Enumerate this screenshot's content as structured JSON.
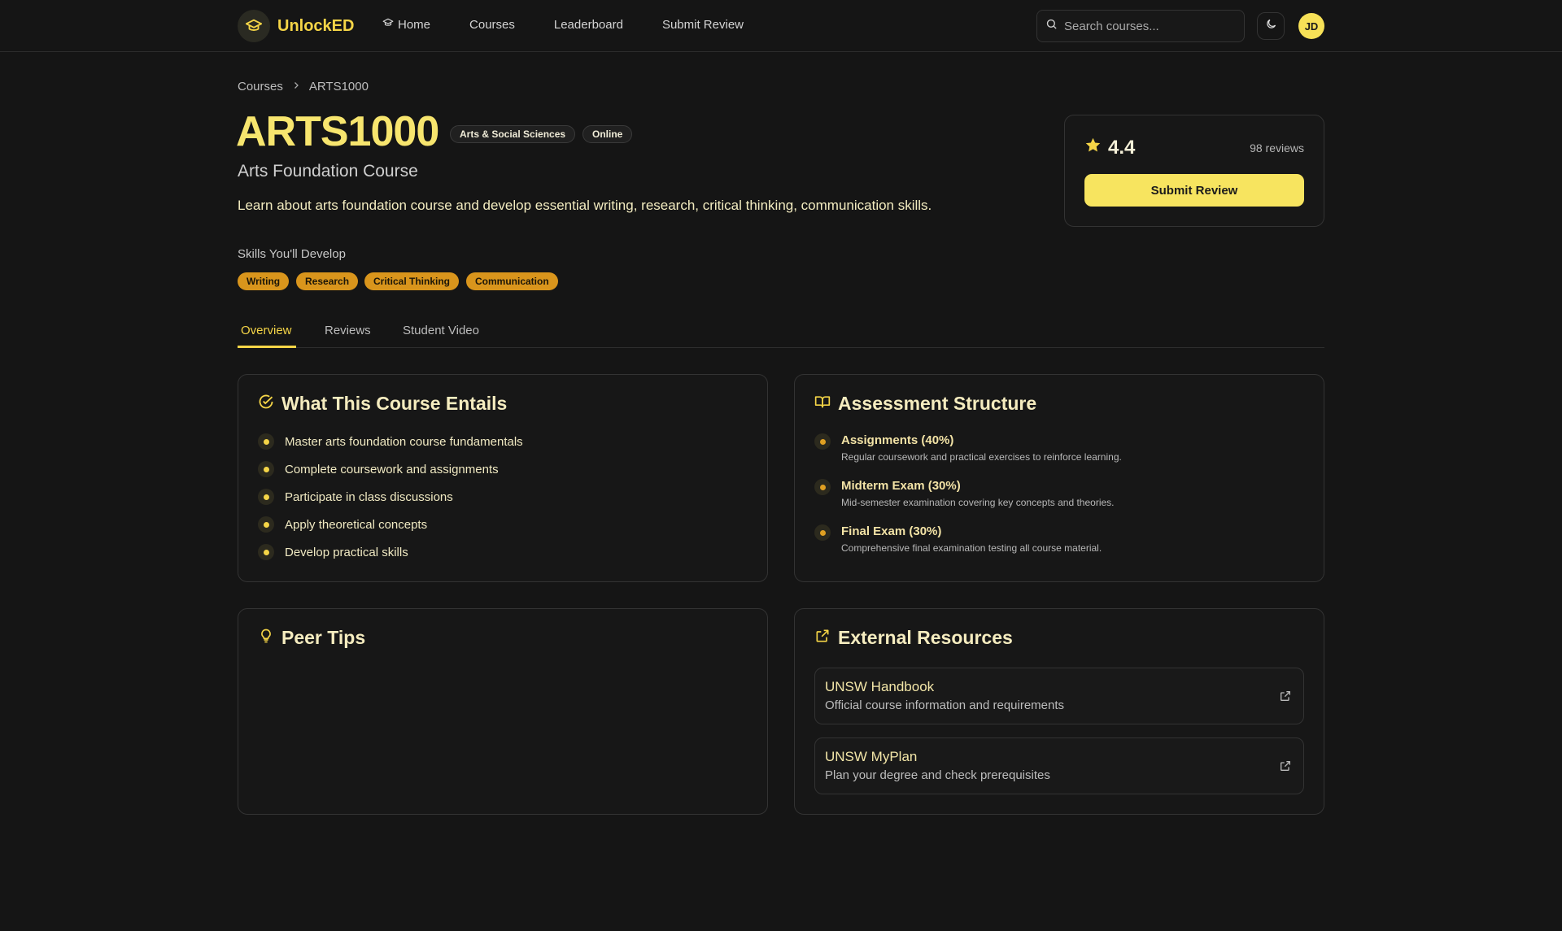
{
  "header": {
    "brand": "UnlockED",
    "nav": [
      {
        "label": "Home",
        "icon": "graduation-cap-icon"
      },
      {
        "label": "Courses"
      },
      {
        "label": "Leaderboard"
      },
      {
        "label": "Submit Review"
      }
    ],
    "search": {
      "placeholder": "Search courses..."
    },
    "avatar_initials": "JD"
  },
  "breadcrumb": {
    "parent": "Courses",
    "current": "ARTS1000"
  },
  "course": {
    "code": "ARTS1000",
    "badges": [
      "Arts & Social Sciences",
      "Online"
    ],
    "name": "Arts Foundation Course",
    "description": "Learn about arts foundation course and develop essential writing, research, critical thinking, communication skills.",
    "skills_heading": "Skills You'll Develop",
    "skills": [
      "Writing",
      "Research",
      "Critical Thinking",
      "Communication"
    ]
  },
  "rating": {
    "value": "4.4",
    "count_label": "98 reviews",
    "submit_label": "Submit Review"
  },
  "tabs": [
    {
      "label": "Overview",
      "active": true
    },
    {
      "label": "Reviews",
      "active": false
    },
    {
      "label": "Student Video",
      "active": false
    }
  ],
  "entails": {
    "title": "What This Course Entails",
    "items": [
      "Master arts foundation course fundamentals",
      "Complete coursework and assignments",
      "Participate in class discussions",
      "Apply theoretical concepts",
      "Develop practical skills"
    ]
  },
  "assessment": {
    "title": "Assessment Structure",
    "items": [
      {
        "name": "Assignments (40%)",
        "desc": "Regular coursework and practical exercises to reinforce learning."
      },
      {
        "name": "Midterm Exam (30%)",
        "desc": "Mid-semester examination covering key concepts and theories."
      },
      {
        "name": "Final Exam (30%)",
        "desc": "Comprehensive final examination testing all course material."
      }
    ]
  },
  "peer_tips": {
    "title": "Peer Tips"
  },
  "resources": {
    "title": "External Resources",
    "items": [
      {
        "title": "UNSW Handbook",
        "subtitle": "Official course information and requirements"
      },
      {
        "title": "UNSW MyPlan",
        "subtitle": "Plan your degree and check prerequisites"
      }
    ]
  },
  "colors": {
    "accent": "#f5d547",
    "skill_tag": "#d9951c",
    "background": "#151515"
  }
}
